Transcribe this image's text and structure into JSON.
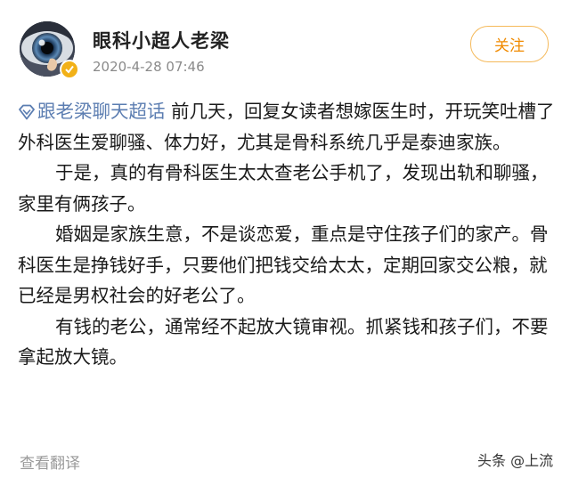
{
  "post": {
    "author": {
      "name": "眼科小超人老梁",
      "avatar_icon": "eye-avatar-icon",
      "verified_icon": "verified-badge-icon",
      "verified_color": "#f2b118"
    },
    "timestamp": "2020-4-28 07:46",
    "follow_label": "关注",
    "topic": {
      "icon": "supertopic-diamond-icon",
      "label": "跟老梁聊天超话"
    },
    "paragraphs": [
      "前几天，回复女读者想嫁医生时，开玩笑吐槽了外科医生爱聊骚、体力好，尤其是骨科系统几乎是泰迪家族。",
      "于是，真的有骨科医生太太查老公手机了，发现出轨和聊骚，家里有俩孩子。",
      "婚姻是家族生意，不是谈恋爱，重点是守住孩子们的家产。骨科医生是挣钱好手，只要他们把钱交给太太，定期回家交公粮，就已经是男权社会的好老公了。",
      "有钱的老公，通常经不起放大镜审视。抓紧钱和孩子们，不要拿起放大镜。"
    ],
    "translate_label": "查看翻译"
  },
  "watermark": "头条 @上流",
  "colors": {
    "link": "#5b7db1",
    "follow_accent": "#f08a00",
    "follow_border": "#f5b95a"
  }
}
